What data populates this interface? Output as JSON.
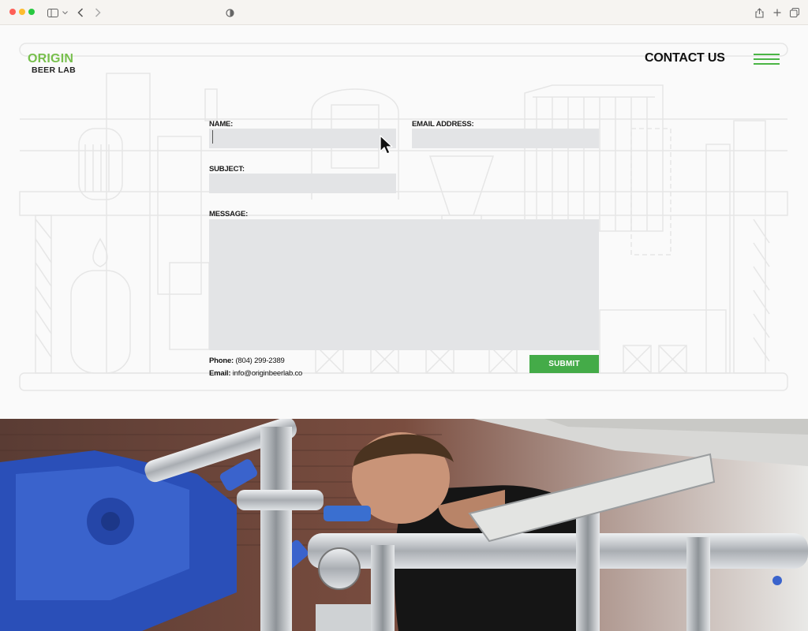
{
  "browser": {
    "icons": [
      "sidebar-toggle-icon",
      "chevron-down-icon",
      "back-arrow-icon",
      "forward-arrow-icon",
      "privacy-shield-icon",
      "share-icon",
      "new-tab-plus-icon",
      "tab-overview-icon"
    ]
  },
  "header": {
    "logo_top": "ORIGIN",
    "logo_bottom": "BEER LAB",
    "contact_link": "CONTACT US",
    "menu_icon": "hamburger-menu-icon",
    "accent_color": "#77bf4c",
    "menu_color": "#4ab545"
  },
  "form": {
    "name_label": "NAME:",
    "name_value": "",
    "email_label": "EMAIL ADDRESS:",
    "email_value": "",
    "subject_label": "SUBJECT:",
    "subject_value": "",
    "message_label": "MESSAGE:",
    "message_value": "",
    "submit_label": "SUBMIT",
    "submit_color": "#44ab48",
    "field_color": "#e3e4e6"
  },
  "contact": {
    "phone_label": "Phone:",
    "phone_value": "(804) 299-2389",
    "email_label": "Email:",
    "email_value": "info@originbeerlab.co"
  }
}
